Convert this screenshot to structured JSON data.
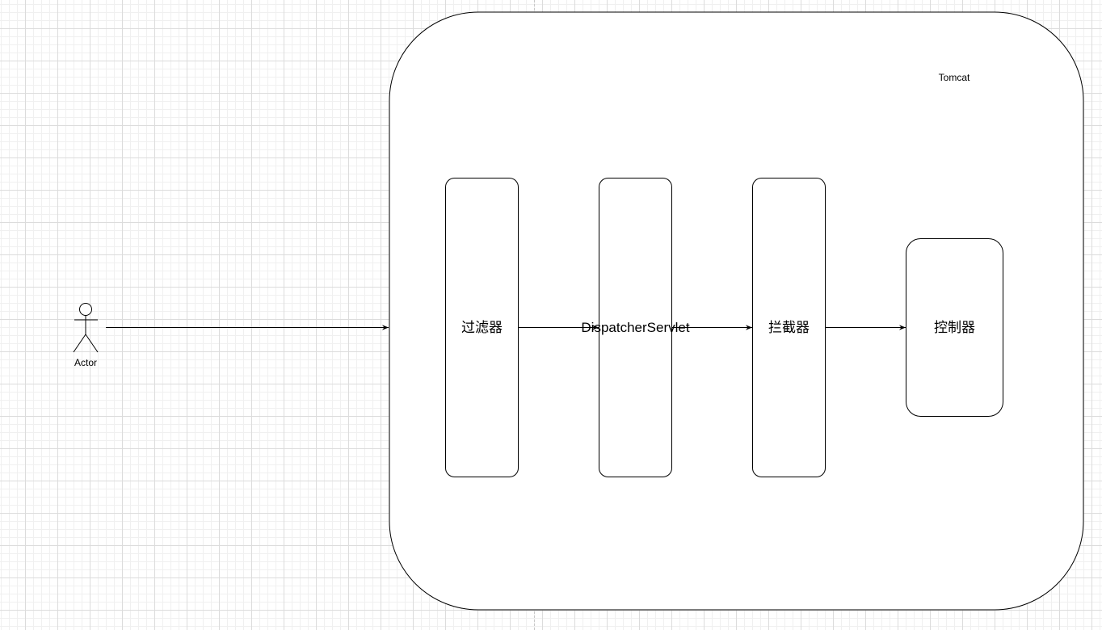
{
  "diagram": {
    "container_label": "Tomcat",
    "actor_label": "Actor",
    "nodes": [
      {
        "id": "filter",
        "label": "过滤器"
      },
      {
        "id": "dispatcher",
        "label": "DispatcherServlet"
      },
      {
        "id": "interceptor",
        "label": "拦截器"
      },
      {
        "id": "controller",
        "label": "控制器"
      }
    ],
    "edges": [
      {
        "from": "actor",
        "to": "tomcat"
      },
      {
        "from": "filter",
        "to": "dispatcher"
      },
      {
        "from": "dispatcher",
        "to": "interceptor"
      },
      {
        "from": "interceptor",
        "to": "controller"
      }
    ],
    "colors": {
      "stroke": "#000000",
      "fill": "#ffffff"
    }
  }
}
